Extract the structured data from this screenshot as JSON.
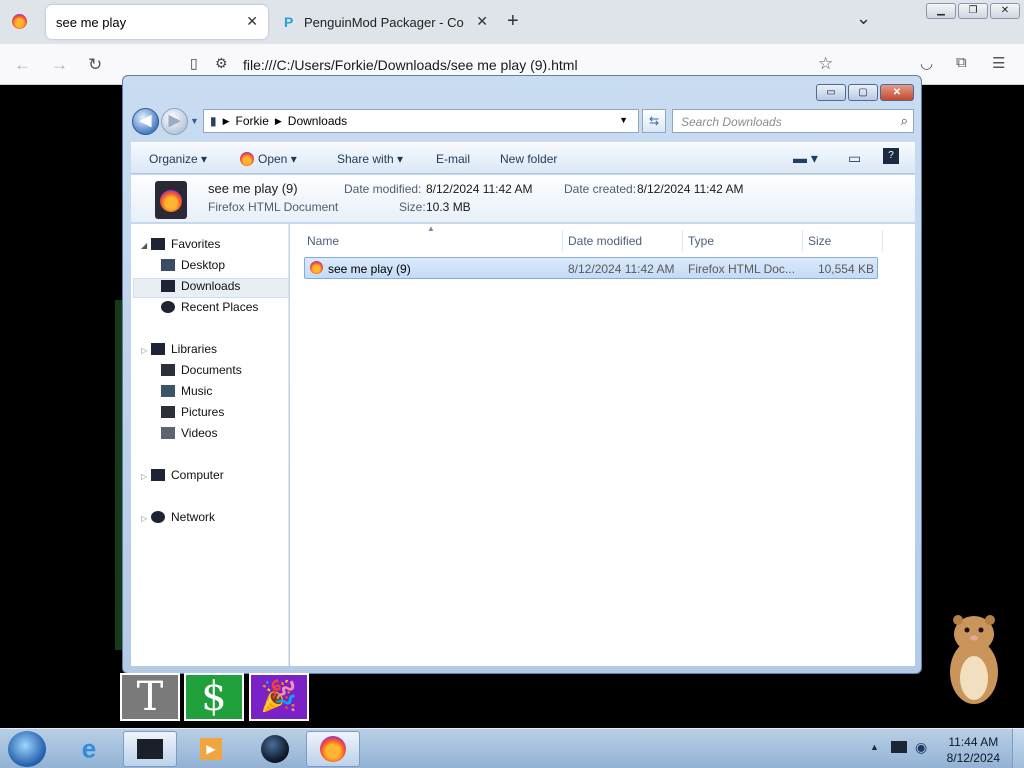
{
  "browser": {
    "tabs": [
      {
        "label": "see me play",
        "close": "✕"
      },
      {
        "label": "PenguinMod Packager - Conve",
        "close": "✕"
      }
    ],
    "new_tab": "+",
    "overflow": "⌄",
    "url": "file:///C:/Users/Forkie/Downloads/see me play (9).html"
  },
  "explorer": {
    "caption_buttons": {
      "minimize": "▭",
      "maximize": "▢",
      "close": "✕"
    },
    "breadcrumb": [
      "Forkie",
      "Downloads"
    ],
    "search_placeholder": "Search Downloads",
    "commands": {
      "organize": "Organize",
      "open": "Open",
      "share_with": "Share with",
      "email": "E-mail",
      "new_folder": "New folder"
    },
    "details": {
      "name": "see me play (9)",
      "type": "Firefox HTML Document",
      "modified_label": "Date modified:",
      "modified_value": "8/12/2024 11:42 AM",
      "created_label": "Date created:",
      "created_value": "8/12/2024 11:42 AM",
      "size_label": "Size:",
      "size_value": "10.3 MB"
    },
    "nav": {
      "favorites": "Favorites",
      "desktop": "Desktop",
      "downloads": "Downloads",
      "recent": "Recent Places",
      "libraries": "Libraries",
      "documents": "Documents",
      "music": "Music",
      "pictures": "Pictures",
      "videos": "Videos",
      "computer": "Computer",
      "network": "Network"
    },
    "columns": {
      "name": "Name",
      "modified": "Date modified",
      "type": "Type",
      "size": "Size"
    },
    "files": [
      {
        "name": "see me play (9)",
        "modified": "8/12/2024 11:42 AM",
        "type": "Firefox HTML Doc...",
        "size": "10,554 KB"
      }
    ]
  },
  "launchers": [
    "T",
    "$"
  ],
  "taskbar": {
    "time": "11:44 AM",
    "date": "8/12/2024"
  },
  "colors": {
    "accent": "#3767a3",
    "selection": "#c3dbf6",
    "launcher_green": "#1fa03a",
    "launcher_purple": "#7a22c8"
  }
}
